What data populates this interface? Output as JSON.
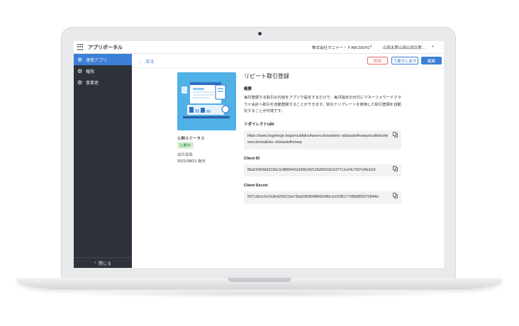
{
  "topbar": {
    "app_title": "アプリポータル",
    "company": "株式会社マニャー・ドABCDEFG",
    "user": "山田太郎山田山田太郎…"
  },
  "sidebar": {
    "items": [
      {
        "label": "連携アプリ",
        "icon": "gear-icon",
        "active": true
      },
      {
        "label": "権限",
        "icon": "gear-icon",
        "active": false
      },
      {
        "label": "事業者",
        "icon": "gear-icon",
        "active": false
      }
    ],
    "collapse_label": "閉じる"
  },
  "toolbar": {
    "back_label": "戻る",
    "delete_label": "削除",
    "draft_label": "下書きに戻す",
    "edit_label": "編集"
  },
  "app": {
    "title": "リピート取引登録",
    "overview_heading": "概要",
    "overview_text": "毎月登録する取引の内容をアプリで設定するだけで、毎月指定の日付にマネーフォワードクラウド会計へ取引を自動登録することができます。取引テンプレートを使用した取引登録を自動化することが可能です。",
    "status_label": "公開ステータス",
    "status_value": "公開中",
    "updated_label": "最終編集",
    "updated_value": "2021/08/21 自分",
    "redirect_label": "リダイレクトURI",
    "redirect_value": "https://www.hogehoge.hoge/ncalfalncfiweorcuhowalinks vdckaulwfhowepncalfalncfiweorcuhowalinks vdckaulwfhowep",
    "client_id_label": "Client ID",
    "client_id_value": "8bd154566d2159c3cf886442d1f08c06f125d99319c5377c1e24c7007ef9cb10",
    "client_secret_label": "Client Secret",
    "client_secret_value": "59713b1c9e163b4293219a72bd33b9548fb05490c2c0185177d58df35575844b"
  },
  "colors": {
    "accent": "#3c7fd6",
    "sidebar_bg": "#2d323b",
    "danger": "#e56a6a",
    "thumb_bg": "#4fb1e6"
  }
}
